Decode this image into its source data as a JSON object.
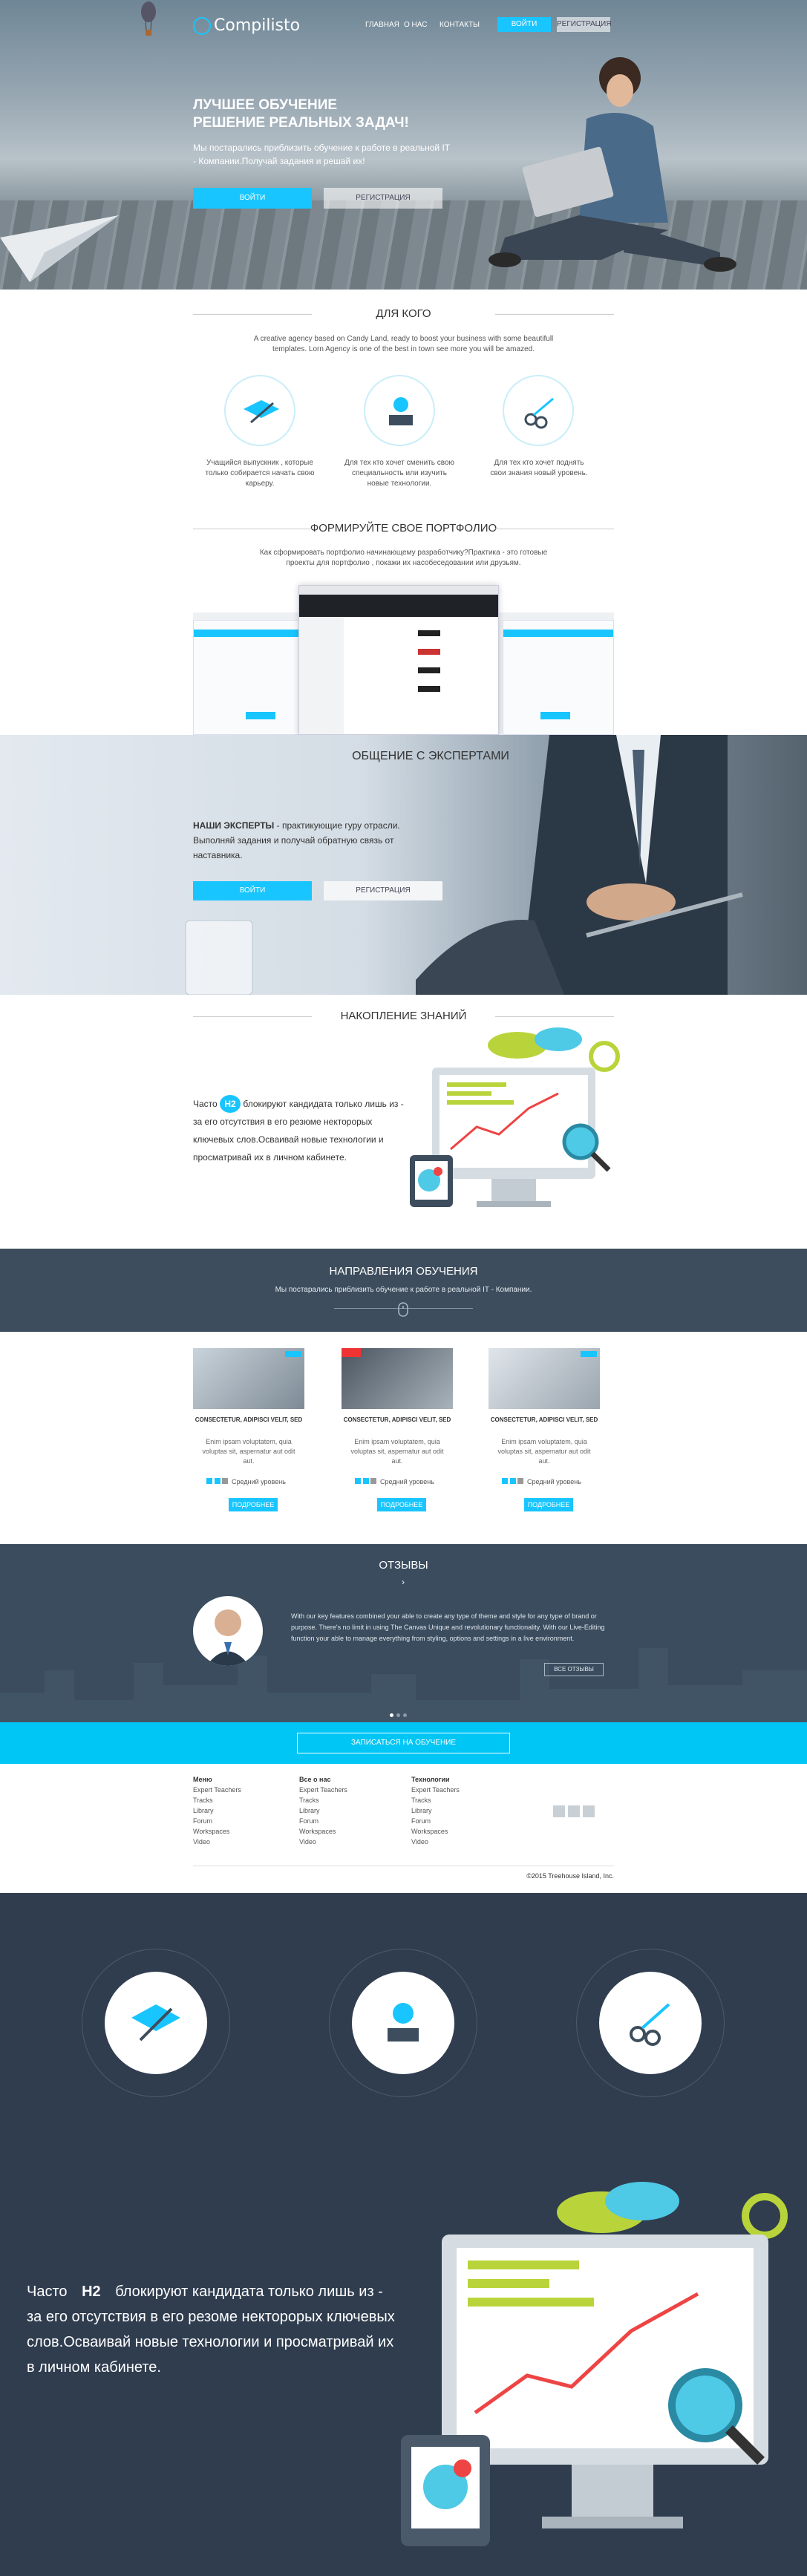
{
  "header": {
    "logo": "Compilisto",
    "nav": [
      "ГЛАВНАЯ",
      "О НАС",
      "КОНТАКТЫ"
    ],
    "login": "ВОЙТИ",
    "register": "РЕГИСТРАЦИЯ"
  },
  "hero": {
    "title_line1": "ЛУЧШЕЕ ОБУЧЕНИЕ",
    "title_line2": "РЕШЕНИЕ РЕАЛЬНЫХ ЗАДАЧ!",
    "text": "Мы постарались приблизить обучение к работе в реальной IT - Компании.Получай задания и решай их!",
    "login": "ВОЙТИ",
    "register": "РЕГИСТРАЦИЯ"
  },
  "who": {
    "title": "ДЛЯ КОГО",
    "intro": "A creative agency based on Candy Land, ready to boost your business with some beautifull templates. Lorn Agency is one of the best in town see more you will be amazed.",
    "items": [
      "Учащийся выпускник , которые только собирается начать свою карьеру.",
      "Для тех кто хочет сменить свою специальность или изучить новые технологии.",
      "Для тех кто хочет поднять свои знания новый уровень."
    ]
  },
  "portfolio": {
    "title": "ФОРМИРУЙТЕ СВОЕ ПОРТФОЛИО",
    "text": "Как сформировать портфолио начинающему разработчику?Практика - это готовые проекты для портфолио , покажи их насобеседовании или друзьям."
  },
  "experts": {
    "title": "ОБЩЕНИЕ С ЭКСПЕРТАМИ",
    "bold": "НАШИ ЭКСПЕРТЫ",
    "text": " - практикующие гуру отрасли. Выполняй задания и получай обратную связь от наставника.",
    "login": "ВОЙТИ",
    "register": "РЕГИСТРАЦИЯ"
  },
  "knowledge": {
    "title": "НАКОПЛЕНИЕ ЗНАНИЙ",
    "pre": "Часто ",
    "badge": "H2",
    "text": " блокируют кандидата только лишь из - за его отсутствия в его резюме некторорых ключевых слов.Осваивай новые технологии и просматривай их в личном кабинете."
  },
  "directions": {
    "title": "НАПРАВЛЕНИЯ ОБУЧЕНИЯ",
    "subtitle": "Мы постарались приблизить обучение к работе в реальной IT - Компании."
  },
  "cards": [
    {
      "title": "CONSECTETUR, ADIPISCI VELIT, SED",
      "text": "Enim ipsam voluptatem, quia voluptas sit, aspernatur aut odit aut.",
      "level": "Средний уровень",
      "button": "ПОДРОБНЕЕ"
    },
    {
      "title": "CONSECTETUR, ADIPISCI VELIT, SED",
      "text": "Enim ipsam voluptatem, quia voluptas sit, aspernatur aut odit aut.",
      "level": "Средний уровень",
      "button": "ПОДРОБНЕЕ"
    },
    {
      "title": "CONSECTETUR, ADIPISCI VELIT, SED",
      "text": "Enim ipsam voluptatem, quia voluptas sit, aspernatur aut odit aut.",
      "level": "Средний уровень",
      "button": "ПОДРОБНЕЕ"
    }
  ],
  "reviews": {
    "title": "ОТЗЫВЫ",
    "text": "With our key features combined your able to create any type of theme and style for any type of brand or purpose. There's no limit in using The Canvas Unique and revolutionary functionality. With our Live-Editing function your able to manage everything from styling, options and settings in a live environment.",
    "all": "ВСЕ ОТЗЫВЫ"
  },
  "signup": {
    "button": "ЗАПИСАТЬСЯ НА ОБУЧЕНИЕ"
  },
  "footer": {
    "cols": [
      {
        "title": "Меню",
        "items": [
          "Expert Teachers",
          "Tracks",
          "Library",
          "Forum",
          "Workspaces",
          "Video"
        ]
      },
      {
        "title": "Все о нас",
        "items": [
          "Expert Teachers",
          "Tracks",
          "Library",
          "Forum",
          "Workspaces",
          "Video"
        ]
      },
      {
        "title": "Технологии",
        "items": [
          "Expert Teachers",
          "Tracks",
          "Library",
          "Forum",
          "Workspaces",
          "Video"
        ]
      }
    ],
    "copyright": "©2015 Treehouse Island, Inc."
  },
  "bottom": {
    "pre": "Часто ",
    "badge": "H2",
    "text": " блокируют кандидата только лишь из - за его отсутствия в его резоме некторорых ключевых слов.Осваивай новые технологии и просматривай их в личном кабинете."
  },
  "colors": {
    "accent": "#19c5ff",
    "dark": "#3d4d5d",
    "signup": "#00c6f5"
  }
}
